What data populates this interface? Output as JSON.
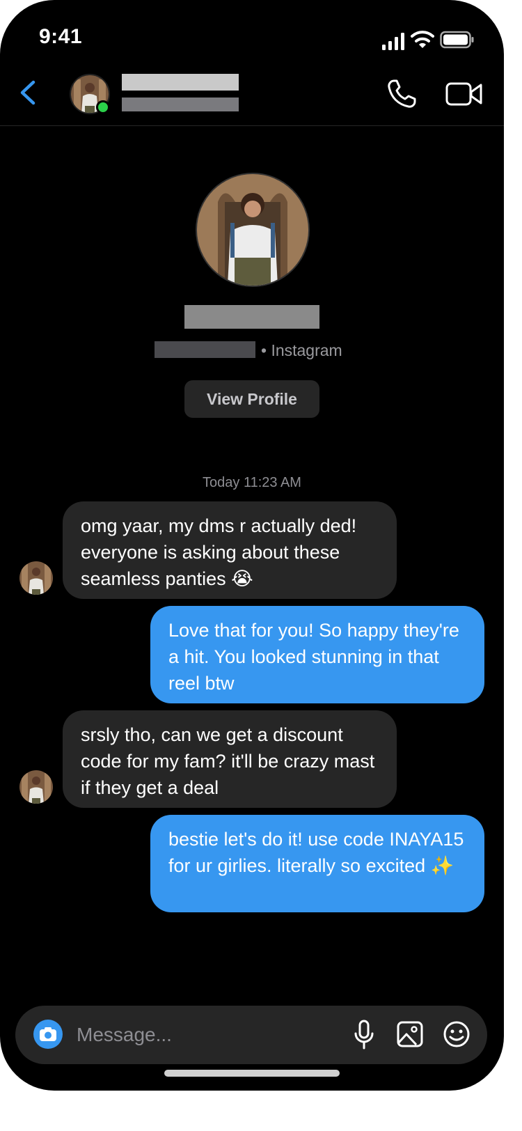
{
  "status_bar": {
    "time": "9:41"
  },
  "profile": {
    "platform_suffix": "• Instagram",
    "view_profile_label": "View Profile"
  },
  "thread": {
    "timestamp": "Today 11:23 AM",
    "messages": [
      {
        "direction": "incoming",
        "text": "omg yaar, my dms r actually ded! everyone is asking about these seamless panties 😭"
      },
      {
        "direction": "outgoing",
        "text": "Love that for you! So happy they're a hit. You looked stunning in that reel btw"
      },
      {
        "direction": "incoming",
        "text": "srsly tho, can we get a discount code for my fam? it'll be crazy mast if they get a deal"
      },
      {
        "direction": "outgoing",
        "text": "bestie let's do it! use code INAYA15 for ur girlies. literally so excited ✨"
      }
    ]
  },
  "composer": {
    "placeholder": "Message..."
  },
  "colors": {
    "outgoing_bubble": "#3797f0",
    "incoming_bubble": "#262626",
    "accent": "#3797f0",
    "online": "#2bd04a"
  },
  "icons": [
    "back-chevron-icon",
    "phone-icon",
    "video-camera-icon",
    "camera-icon",
    "microphone-icon",
    "gallery-icon",
    "emoji-icon"
  ]
}
